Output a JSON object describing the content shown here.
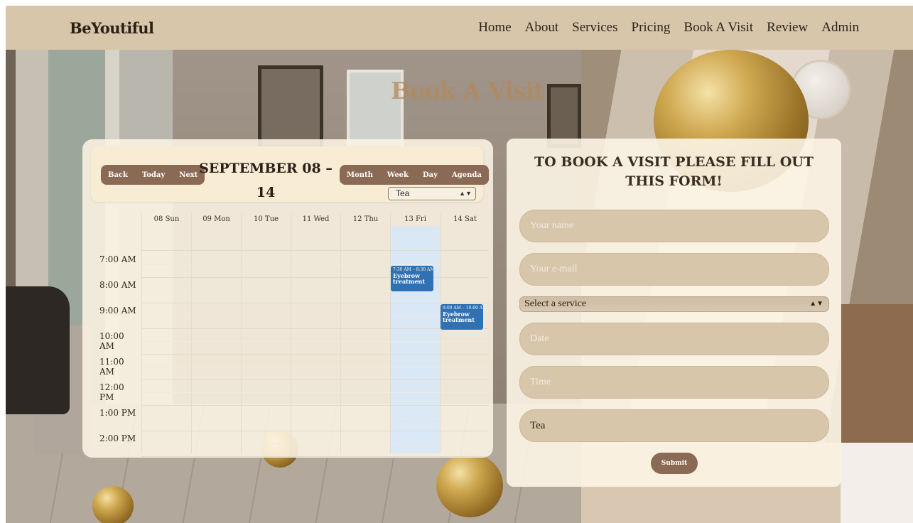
{
  "brand": "BeYoutiful",
  "nav": [
    "Home",
    "About",
    "Services",
    "Pricing",
    "Book A Visit",
    "Review",
    "Admin"
  ],
  "page_title": "Book A Visit",
  "calendar": {
    "nav_buttons": [
      "Back",
      "Today",
      "Next"
    ],
    "label": "SEPTEMBER 08 – 14",
    "view_buttons": [
      "Month",
      "Week",
      "Day",
      "Agenda"
    ],
    "resource_selected": "Tea",
    "days": [
      "08 Sun",
      "09 Mon",
      "10 Tue",
      "11 Wed",
      "12 Thu",
      "13 Fri",
      "14 Sat"
    ],
    "today_index": 5,
    "times": [
      "7:00 AM",
      "8:00 AM",
      "9:00 AM",
      "10:00 AM",
      "11:00 AM",
      "12:00 PM",
      "1:00 PM",
      "2:00 PM"
    ],
    "events": [
      {
        "day": 5,
        "start_hour": 7.5,
        "end_hour": 8.5,
        "time_text": "7:30 AM – 8:30 AM",
        "title": "Eyebrow treatment"
      },
      {
        "day": 6,
        "start_hour": 9.0,
        "end_hour": 10.0,
        "time_text": "9:00 AM – 10:00 AM",
        "title": "Eyebrow treatment"
      }
    ]
  },
  "form": {
    "title": "TO BOOK A VISIT PLEASE FILL OUT THIS FORM!",
    "name_placeholder": "Your name",
    "email_placeholder": "Your e-mail",
    "service_selected": "Select a service",
    "date_placeholder": "Date",
    "time_placeholder": "Time",
    "extra_value": "Tea",
    "submit_label": "Submit"
  },
  "colors": {
    "navbar": "#d8c6ab",
    "button": "#8b6a55",
    "event": "#3071b3",
    "today_column": "#d6e8fa"
  }
}
